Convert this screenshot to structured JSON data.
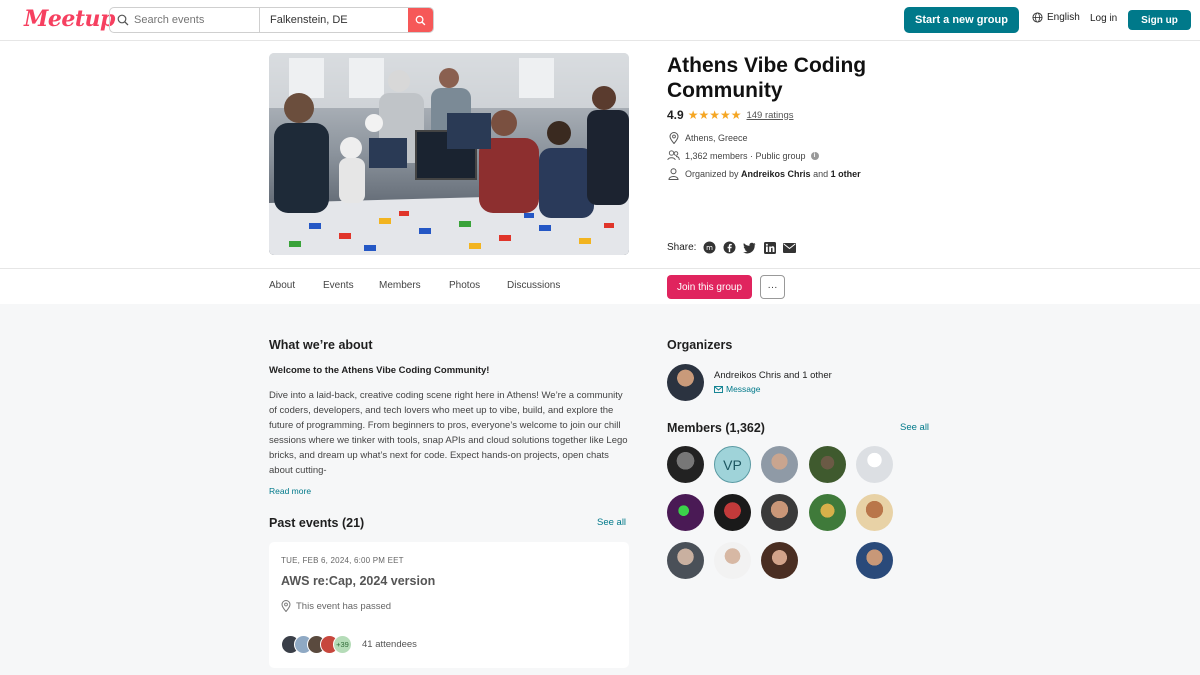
{
  "header": {
    "logo": "Meetup",
    "search_placeholder": "Search events",
    "location_value": "Falkenstein, DE",
    "start_group_label": "Start a new group",
    "language_label": "English",
    "login_label": "Log in",
    "signup_label": "Sign up"
  },
  "group": {
    "title": "Athens Vibe Coding Community",
    "rating": "4.9",
    "stars": "★★★★★",
    "ratings_text": "149 ratings",
    "location": "Athens, Greece",
    "members_info": "1,362 members · Public group",
    "organized_prefix": "Organized by",
    "organizer_name": "Andreikos Chris",
    "organized_and": "and",
    "organized_other": "1 other",
    "share_label": "Share:"
  },
  "tabs": {
    "items": [
      "About",
      "Events",
      "Members",
      "Photos",
      "Discussions"
    ],
    "join_label": "Join this group",
    "more_label": "···"
  },
  "about": {
    "heading": "What we’re about",
    "welcome": "Welcome to the Athens Vibe Coding Community!",
    "description": "Dive into a laid-back, creative coding scene right here in Athens! We’re a community of coders, developers, and tech lovers who meet up to vibe, build, and explore the future of programming. From beginners to pros, everyone’s welcome to join our chill sessions where we tinker with tools, snap APIs and cloud solutions together like Lego bricks, and dream up what’s next for code. Expect hands-on projects, open chats about cutting-",
    "read_more": "Read more"
  },
  "past_events": {
    "heading": "Past events (21)",
    "see_all": "See all",
    "event": {
      "date": "TUE, FEB 6, 2024, 6:00 PM EET",
      "title": "AWS re:Cap, 2024 version",
      "status": "This event has passed",
      "attendee_more": "+39",
      "attendees": "41 attendees"
    }
  },
  "organizers": {
    "heading": "Organizers",
    "name": "Andreikos Chris",
    "and_text": "and",
    "other": "1 other",
    "message_label": "Message"
  },
  "members": {
    "heading": "Members (1,362)",
    "see_all": "See all",
    "vp_initials": "VP"
  },
  "colors": {
    "brand": "#f64060",
    "teal": "#00798a",
    "join": "#e0245e",
    "star": "#f5a623"
  }
}
